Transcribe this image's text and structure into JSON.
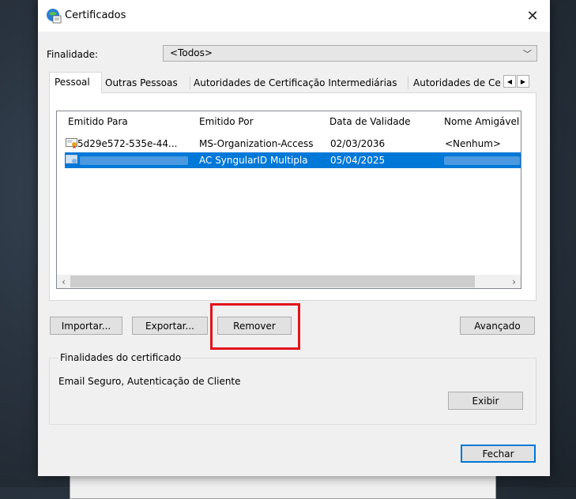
{
  "dialog": {
    "title": "Certificados",
    "purpose_label": "Finalidade:",
    "purpose_value": "<Todos>"
  },
  "tabs": [
    {
      "label": "Pessoal"
    },
    {
      "label": "Outras Pessoas"
    },
    {
      "label": "Autoridades de Certificação Intermediárias"
    },
    {
      "label": "Autoridades de Ce"
    }
  ],
  "table": {
    "columns": [
      "Emitido Para",
      "Emitido Por",
      "Data de Validade",
      "Nome Amigável"
    ],
    "rows": [
      {
        "issued_to": "5d29e572-535e-44...",
        "issued_by": "MS-Organization-Access",
        "expiry": "02/03/2036",
        "friendly_name": "<Nenhum>",
        "selected": false
      },
      {
        "issued_to": "",
        "issued_by": "AC SyngularID Multipla",
        "expiry": "05/04/2025",
        "friendly_name": "",
        "selected": true
      }
    ]
  },
  "buttons": {
    "import": "Importar...",
    "export": "Exportar...",
    "remove": "Remover",
    "advanced": "Avançado",
    "view": "Exibir",
    "close": "Fechar"
  },
  "purposes_group": {
    "title": "Finalidades do certificado",
    "text": "Email Seguro, Autenticação de Cliente"
  },
  "colors": {
    "selection": "#0078d7",
    "highlight_box": "#e3121b"
  }
}
